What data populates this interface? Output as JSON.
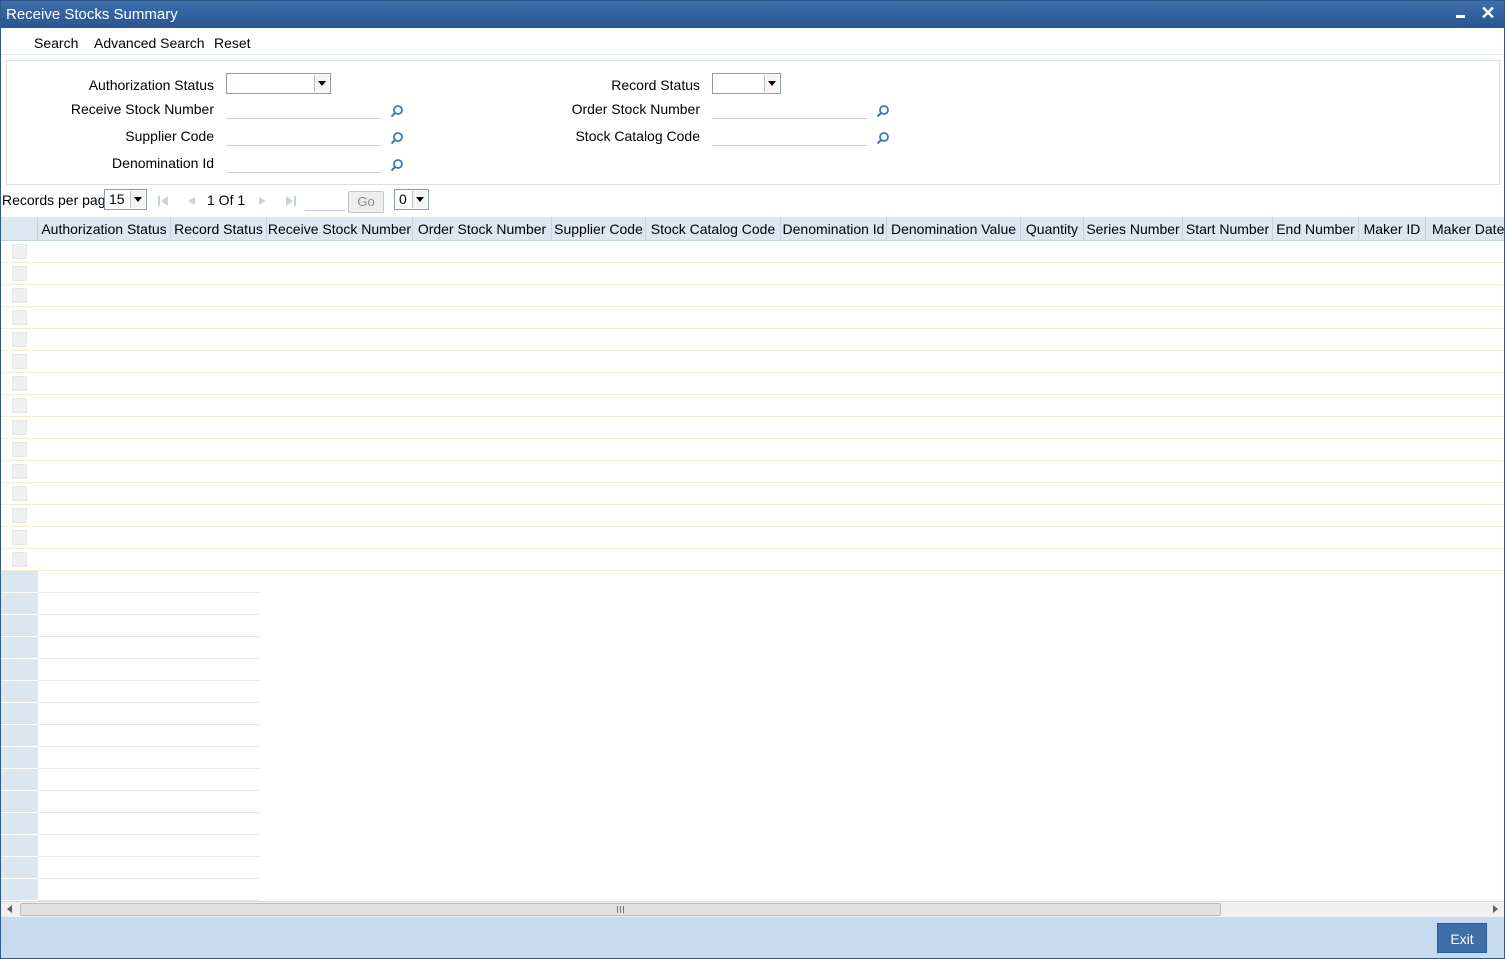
{
  "window": {
    "title": "Receive Stocks Summary"
  },
  "toolbar": {
    "search": "Search",
    "advanced_search": "Advanced Search",
    "reset": "Reset"
  },
  "criteria": {
    "authorization_status": {
      "label": "Authorization Status",
      "value": ""
    },
    "record_status": {
      "label": "Record Status",
      "value": ""
    },
    "receive_stock_number": {
      "label": "Receive Stock Number",
      "value": ""
    },
    "order_stock_number": {
      "label": "Order Stock Number",
      "value": ""
    },
    "supplier_code": {
      "label": "Supplier Code",
      "value": ""
    },
    "stock_catalog_code": {
      "label": "Stock Catalog Code",
      "value": ""
    },
    "denomination_id": {
      "label": "Denomination Id",
      "value": ""
    }
  },
  "pager": {
    "records_per_page_label": "Records per page",
    "records_per_page": "15",
    "page_of": "1 Of 1",
    "goto_value": "",
    "go_label": "Go",
    "select_value": "0"
  },
  "grid": {
    "columns": [
      "Authorization Status",
      "Record Status",
      "Receive Stock Number",
      "Order Stock Number",
      "Supplier Code",
      "Stock Catalog Code",
      "Denomination Id",
      "Denomination Value",
      "Quantity",
      "Series Number",
      "Start Number",
      "End Number",
      "Maker ID",
      "Maker Date Stam"
    ],
    "rows": []
  },
  "footer": {
    "exit": "Exit"
  },
  "colors": {
    "titlebar": "#2a5693",
    "header_bg": "#dde7f1",
    "footer_bg": "#c6dcee",
    "exit_btn": "#3d6ea8"
  }
}
